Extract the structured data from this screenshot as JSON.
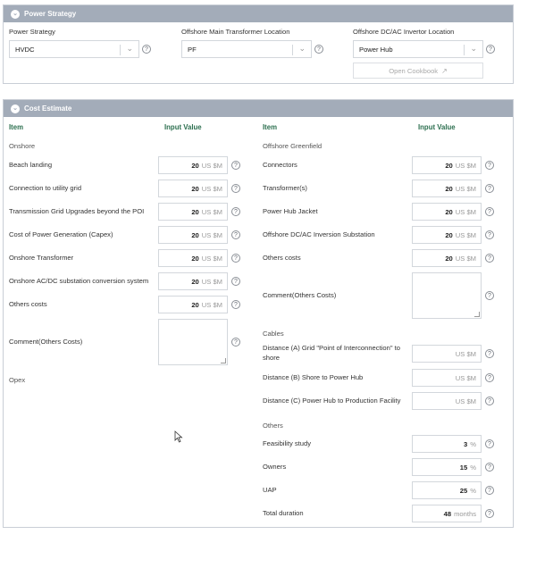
{
  "power_strategy_panel": {
    "header": "Power Strategy",
    "fields": [
      {
        "label": "Power Strategy",
        "value": "HVDC"
      },
      {
        "label": "Offshore Main Transformer Location",
        "value": "PF"
      },
      {
        "label": "Offshore DC/AC Invertor Location",
        "value": "Power Hub"
      }
    ],
    "cookbook_label": "Open Cookbook",
    "cookbook_icon": "external-link-icon"
  },
  "cost_panel": {
    "header": "Cost Estimate",
    "col_item": "Item",
    "col_input": "Input Value",
    "left": {
      "section_onshore": "Onshore",
      "rows": [
        {
          "label": "Beach landing",
          "value": "20",
          "unit": "US $M"
        },
        {
          "label": "Connection to utility grid",
          "value": "20",
          "unit": "US $M"
        },
        {
          "label": "Transmission Grid Upgrades beyond the POI",
          "value": "20",
          "unit": "US $M"
        },
        {
          "label": "Cost of Power Generation (Capex)",
          "value": "20",
          "unit": "US $M"
        },
        {
          "label": "Onshore Transformer",
          "value": "20",
          "unit": "US $M"
        },
        {
          "label": "Onshore AC/DC substation conversion system",
          "value": "20",
          "unit": "US $M"
        },
        {
          "label": "Others costs",
          "value": "20",
          "unit": "US $M"
        }
      ],
      "comment_label": "Comment(Others Costs)",
      "section_opex": "Opex"
    },
    "right": {
      "section_greenfield": "Offshore Greenfield",
      "rows": [
        {
          "label": "Connectors",
          "value": "20",
          "unit": "US $M"
        },
        {
          "label": "Transformer(s)",
          "value": "20",
          "unit": "US $M"
        },
        {
          "label": "Power Hub Jacket",
          "value": "20",
          "unit": "US $M"
        },
        {
          "label": "Offshore DC/AC Inversion Substation",
          "value": "20",
          "unit": "US $M"
        },
        {
          "label": "Others costs",
          "value": "20",
          "unit": "US $M"
        }
      ],
      "comment_label": "Comment(Others Costs)",
      "section_cables": "Cables",
      "cable_rows": [
        {
          "label_1": "Distance (A) Grid \"Point of Interconnection\" to",
          "label_2": "shore",
          "value": "",
          "unit": "US $M"
        },
        {
          "label_1": "Distance (B) Shore to Power Hub",
          "label_2": "",
          "value": "",
          "unit": "US $M"
        },
        {
          "label_1": "Distance (C) Power Hub to Production Facility",
          "label_2": "",
          "value": "",
          "unit": "US $M"
        }
      ],
      "section_others": "Others",
      "other_rows": [
        {
          "label": "Feasibility study",
          "value": "3",
          "unit": "%"
        },
        {
          "label": "Owners",
          "value": "15",
          "unit": "%"
        },
        {
          "label": "UAP",
          "value": "25",
          "unit": "%"
        },
        {
          "label": "Total duration",
          "value": "48",
          "unit": "months"
        }
      ]
    }
  },
  "icons": {
    "help": "?",
    "chevron": "⌄",
    "collapse": "⌄"
  }
}
